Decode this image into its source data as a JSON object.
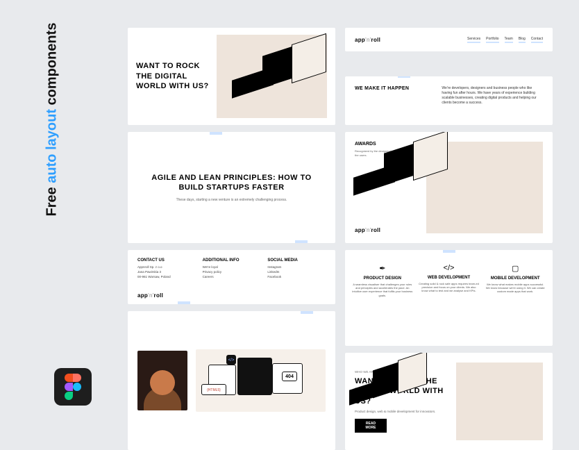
{
  "sidebar": {
    "pre": "Free ",
    "accent": "auto layout",
    "post": " components"
  },
  "hero": {
    "heading": "WANT TO ROCK THE DIGITAL WORLD WITH US?"
  },
  "logo": {
    "part1": "app",
    "part2": "'n'",
    "part3": "roll"
  },
  "nav": {
    "items": [
      "Services",
      "Portfolio",
      "Team",
      "Blog",
      "Contact"
    ]
  },
  "happen": {
    "title": "WE MAKE IT HAPPEN",
    "body": "We're developers, designers and business people who like having fun after hours. We have years of experience building scalable businesses, creating digital products and helping our clients become a success."
  },
  "agile": {
    "heading": "AGILE AND LEAN PRINCIPLES: HOW TO BUILD STARTUPS FASTER",
    "sub": "These days, starting a new venture is an extremely challenging process."
  },
  "awards": {
    "title": "AWARDS",
    "sub": "Recognized by the designers' community. Loved by the users."
  },
  "contact": {
    "col1": {
      "title": "CONTACT US",
      "l1": "Appnroll Sp. z o.o",
      "l2": "Jana Pawirskia 3",
      "l3": "00-961 Warsaw, Poland"
    },
    "col2": {
      "title": "ADDITIONAL INFO",
      "l1": "We're loyal",
      "l2": "Privacy policy",
      "l3": "Careers"
    },
    "col3": {
      "title": "SOCIAL MEDIA",
      "l1": "Instagram",
      "l2": "LinkedIn",
      "l3": "Facebook"
    }
  },
  "services": {
    "s1": {
      "title": "PRODUCT DESIGN",
      "body": "A seamless visualiser that challenges your rules and principles and accelerates the pace. An intuitive user experience that fulfils your business goals."
    },
    "s2": {
      "title": "WEB DEVELOPMENT",
      "body": "Creating solid & rock safe apps requires team-ed precision and focus on your clients. We also know what to test and we analyse and KPIs."
    },
    "s3": {
      "title": "MOBILE DEVELOPMENT",
      "body": "We know what makes mobile apps successful. We know because we're using it. We can create custom made apps that work."
    }
  },
  "dev": {
    "tag1": "{HTML5}",
    "tag2": "</>",
    "tag3": "404"
  },
  "cta": {
    "pre": "WHO WE ARE",
    "heading": "WANT TO ROCK THE DIGITAL WORLD WITH US?",
    "sub": "Product design, web & mobile development for innovators.",
    "btn": "READ MORE"
  }
}
